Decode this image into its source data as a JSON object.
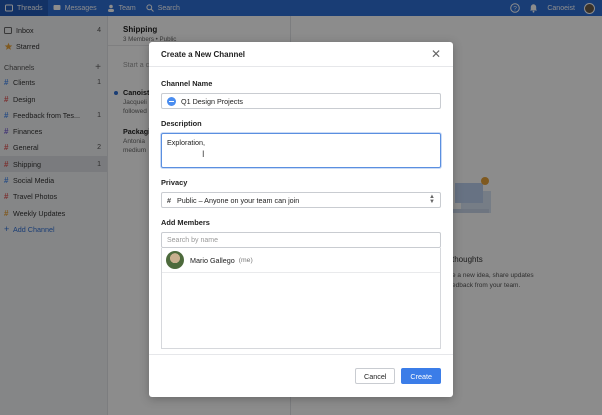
{
  "topbar": {
    "threads": "Threads",
    "messages": "Messages",
    "team": "Team",
    "search": "Search",
    "user": "Canoeist"
  },
  "sidebar": {
    "inbox": {
      "label": "Inbox",
      "count": "4"
    },
    "starred": {
      "label": "Starred"
    },
    "channels_header": "Channels",
    "channels": [
      {
        "label": "Clients",
        "count": "1",
        "color": "#4a8df0"
      },
      {
        "label": "Design",
        "count": "",
        "color": "#e05a5a"
      },
      {
        "label": "Feedback from Tes...",
        "count": "1",
        "color": "#4a8df0"
      },
      {
        "label": "Finances",
        "count": "",
        "color": "#7a63d6"
      },
      {
        "label": "General",
        "count": "2",
        "color": "#e05a5a"
      },
      {
        "label": "Shipping",
        "count": "1",
        "color": "#e05a5a"
      },
      {
        "label": "Social Media",
        "count": "",
        "color": "#4a8df0"
      },
      {
        "label": "Travel Photos",
        "count": "",
        "color": "#e05a5a"
      },
      {
        "label": "Weekly Updates",
        "count": "",
        "color": "#e8a23a"
      }
    ],
    "add_channel": "Add Channel"
  },
  "middle": {
    "title": "Shipping",
    "subtitle": "3 Members • Public",
    "start": "Start a c",
    "threads": [
      {
        "title": "Canoist",
        "line1": "Jacqueli",
        "line2": "followed"
      },
      {
        "title": "Packagi",
        "line1": "Antonia",
        "line2": "medium"
      }
    ]
  },
  "right": {
    "title": "thoughts",
    "line1": "e a new idea, share updates",
    "line2": "edback from your team."
  },
  "modal": {
    "title": "Create a New Channel",
    "channel_name_label": "Channel Name",
    "channel_name_value": "Q1 Design Projects",
    "description_label": "Description",
    "description_value": "Exploration,",
    "privacy_label": "Privacy",
    "privacy_value": "Public – Anyone on your team can join",
    "add_members_label": "Add Members",
    "search_placeholder": "Search by name",
    "members": [
      {
        "name": "Mario Gallego",
        "tag": "(me)"
      }
    ],
    "cancel": "Cancel",
    "create": "Create"
  },
  "colors": {
    "topbar": "#2f6fd6",
    "primary_button": "#3b7de8"
  }
}
